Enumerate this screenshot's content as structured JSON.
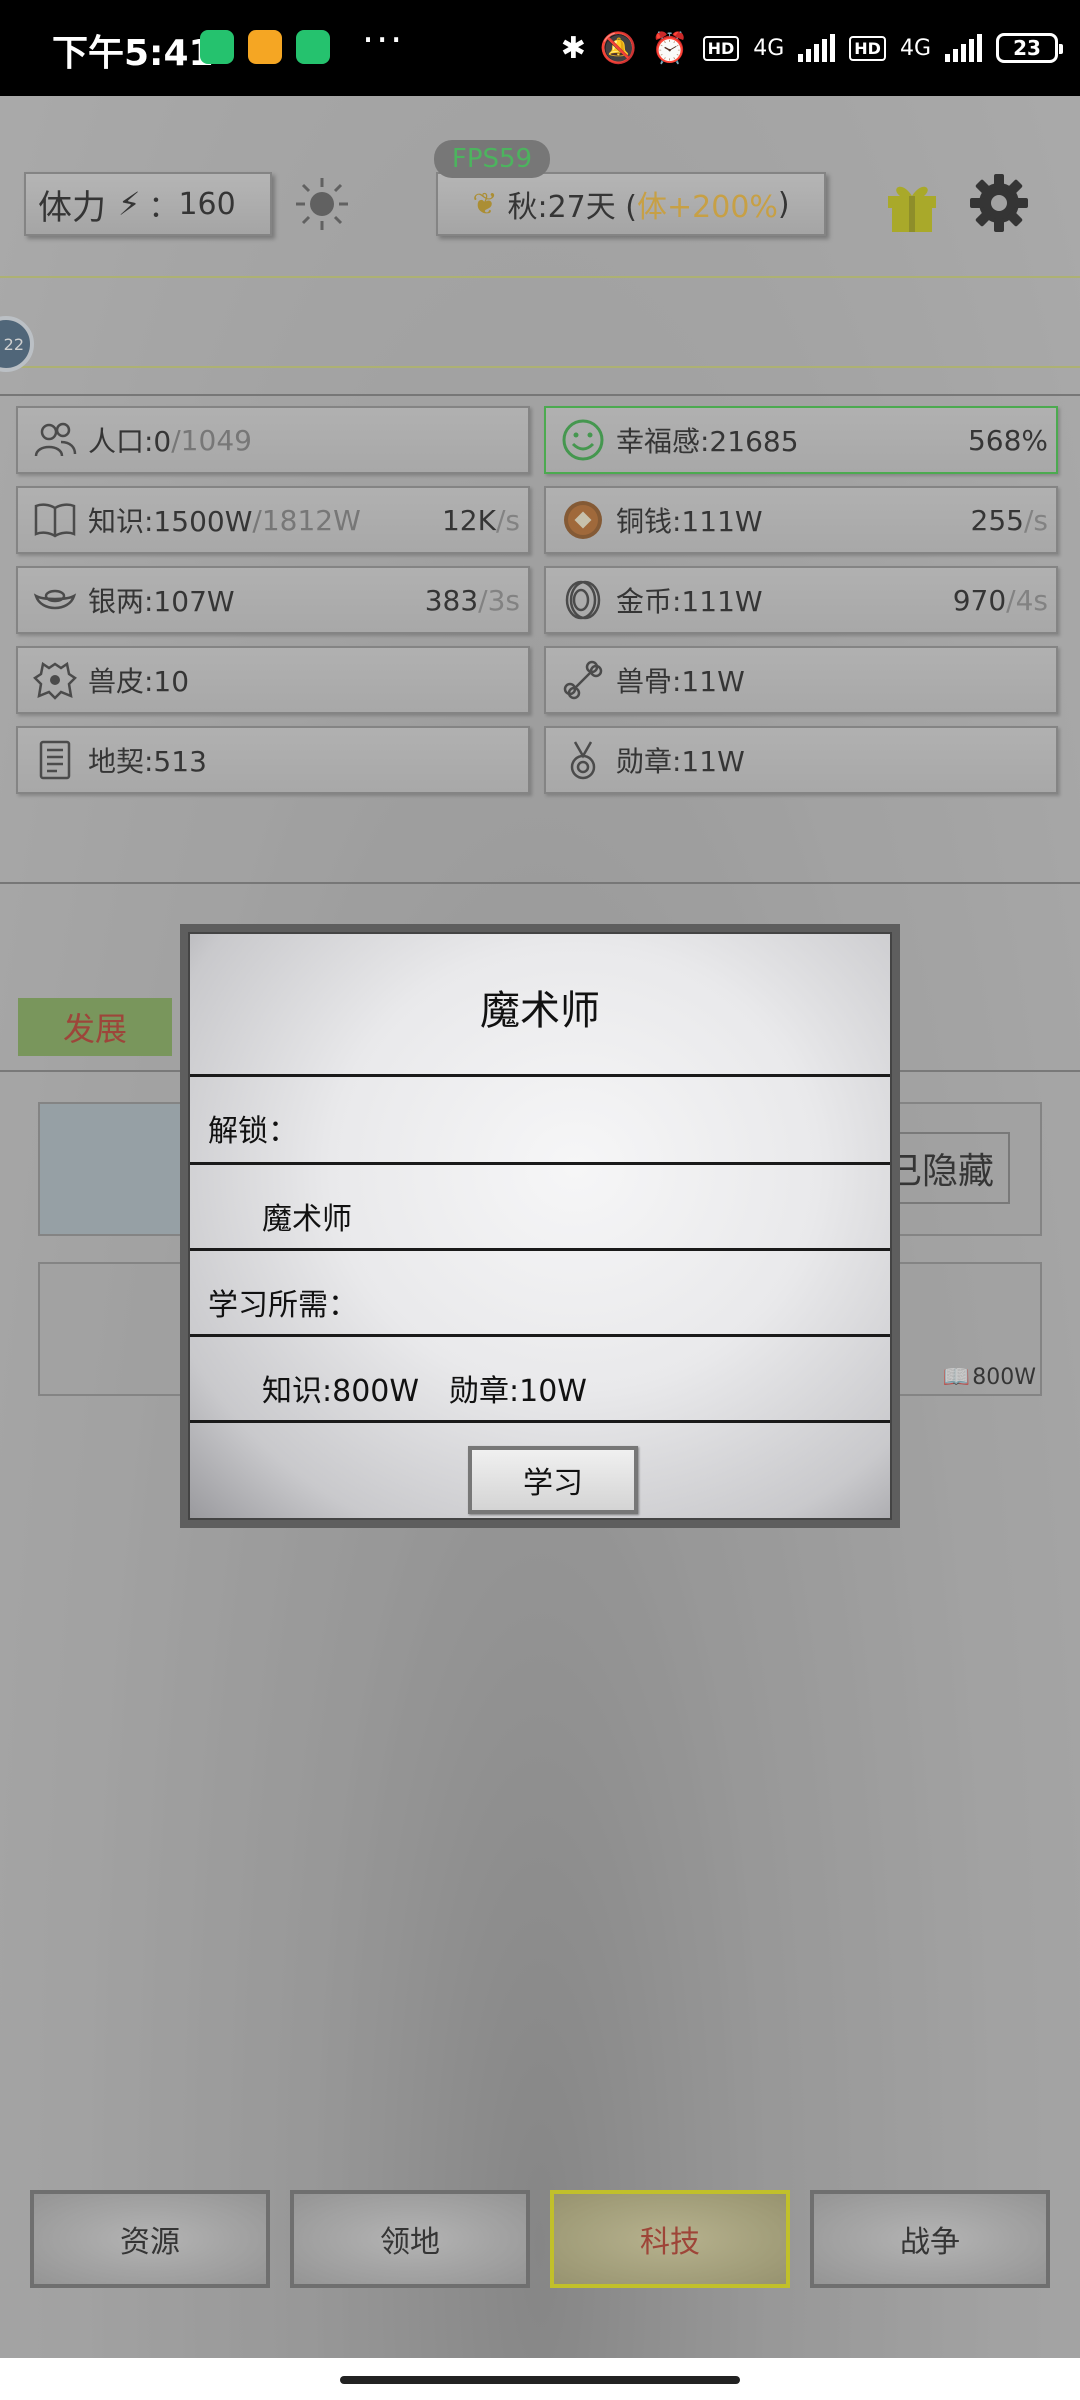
{
  "status_bar": {
    "time": "下午5:41",
    "dots": "···",
    "hd1": "HD",
    "net1": "4G",
    "hd2": "HD",
    "net2": "4G",
    "battery": "23"
  },
  "top": {
    "stamina_label": "体力",
    "stamina_sep": "：",
    "stamina_value": "160",
    "fps": "FPS59",
    "season_text": "秋:27天 (",
    "season_bonus": "体+200%",
    "season_close": ")"
  },
  "resources": [
    {
      "label": "人口:0",
      "max": "/1049",
      "rate": "",
      "unit": "",
      "icon": "people-icon"
    },
    {
      "label": "幸福感:21685",
      "max": "",
      "rate": "568%",
      "unit": "",
      "icon": "smile-icon"
    },
    {
      "label": "知识:1500W",
      "max": "/1812W",
      "rate": "12K",
      "unit": "/s",
      "icon": "book-icon"
    },
    {
      "label": "铜钱:111W",
      "max": "",
      "rate": "255",
      "unit": "/s",
      "icon": "copper-coin-icon"
    },
    {
      "label": "银两:107W",
      "max": "",
      "rate": "383",
      "unit": "/3s",
      "icon": "silver-ingot-icon"
    },
    {
      "label": "金币:111W",
      "max": "",
      "rate": "970",
      "unit": "/4s",
      "icon": "gold-coin-icon"
    },
    {
      "label": "兽皮:10",
      "max": "",
      "rate": "",
      "unit": "",
      "icon": "pelt-icon"
    },
    {
      "label": "兽骨:11W",
      "max": "",
      "rate": "",
      "unit": "",
      "icon": "bone-icon"
    },
    {
      "label": "地契:513",
      "max": "",
      "rate": "",
      "unit": "",
      "icon": "deed-icon"
    },
    {
      "label": "勋章:11W",
      "max": "",
      "rate": "",
      "unit": "",
      "icon": "medal-icon"
    }
  ],
  "tech": {
    "develop_tab": "发展",
    "hidden_button": "已隐藏",
    "card2_cost": "800W"
  },
  "dialog": {
    "title": "魔术师",
    "unlock_label": "解锁：",
    "unlock_value": "魔术师",
    "require_label": "学习所需：",
    "require_value": "知识:800W　勋章:10W",
    "learn_button": "学习"
  },
  "nav": {
    "resources": "资源",
    "territory": "领地",
    "tech": "科技",
    "war": "战争"
  },
  "colors": {
    "fps_text": "#35d450",
    "bonus_text": "#f1b52a",
    "happiness_border": "#35c53b",
    "develop_tab_bg": "#7aa64e",
    "active_nav_border": "#e8e600"
  }
}
